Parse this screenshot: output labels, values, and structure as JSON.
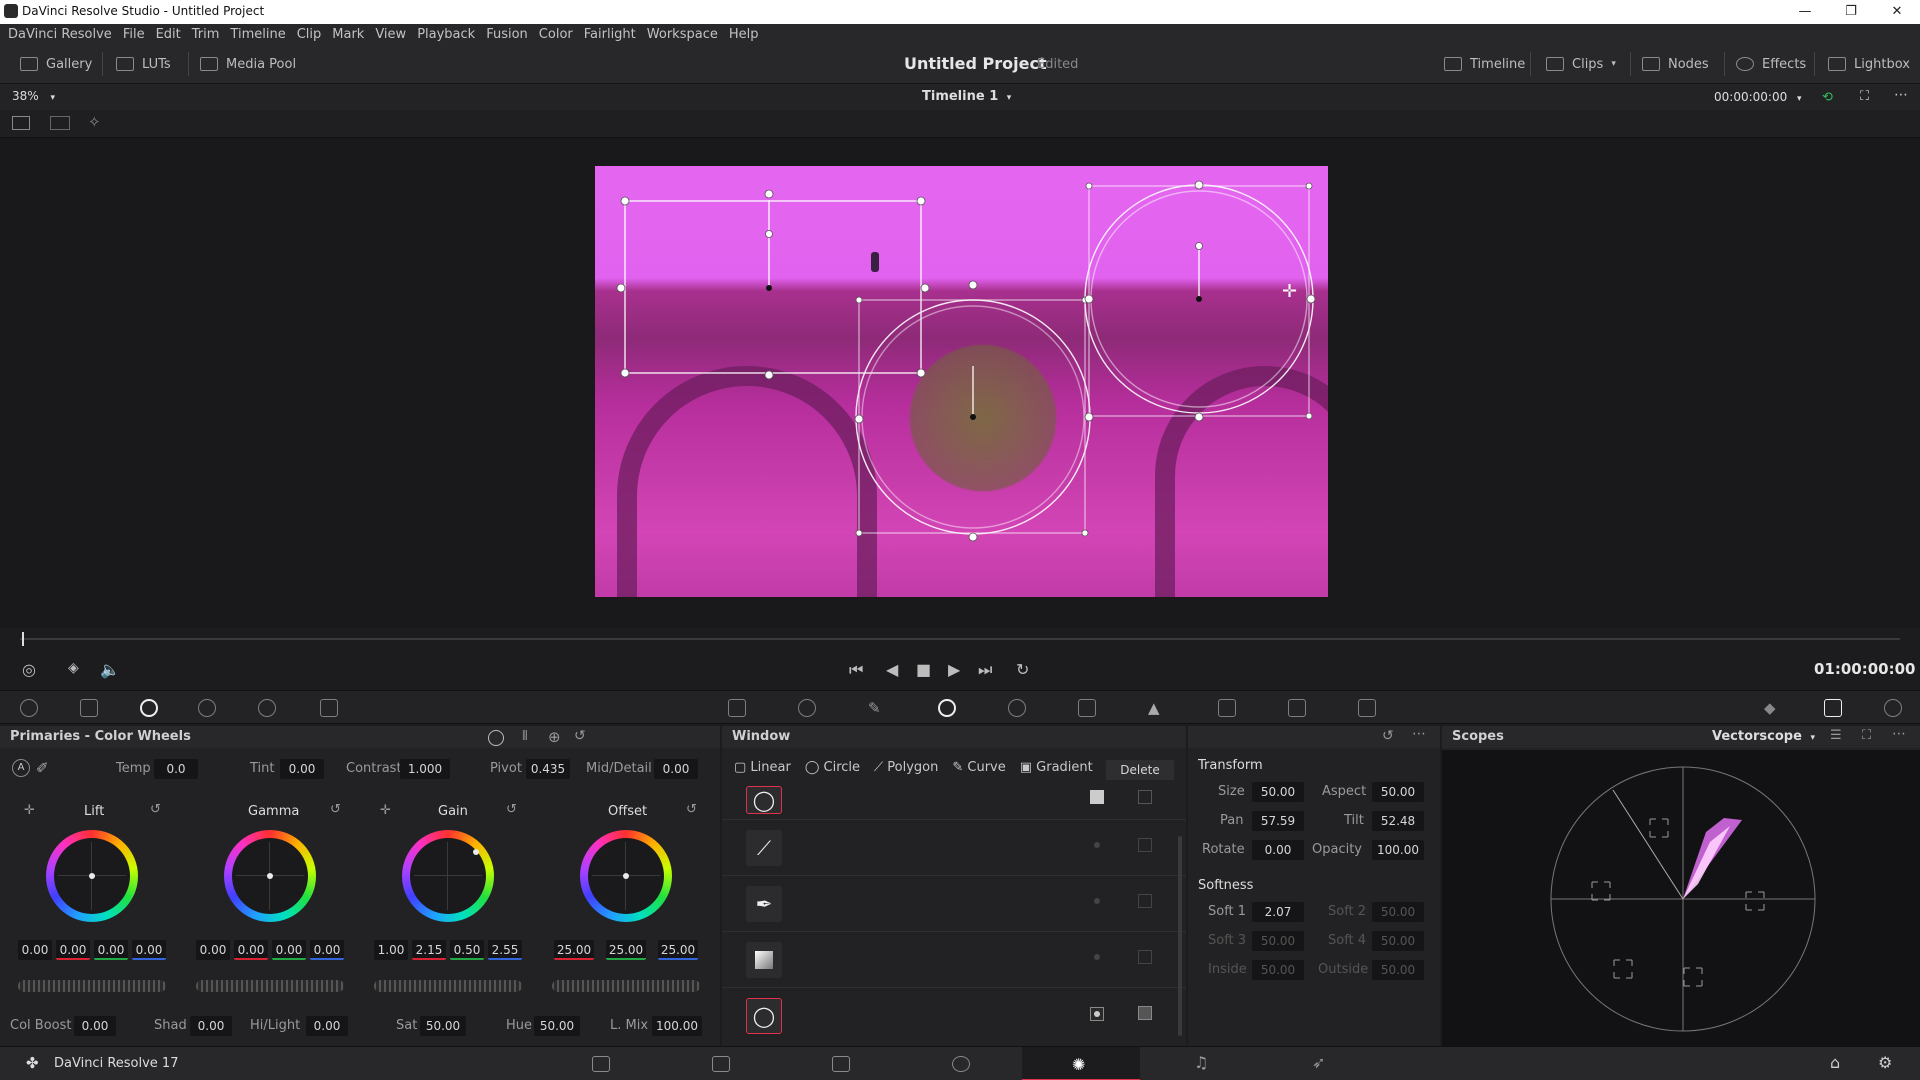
{
  "window": {
    "title": "DaVinci Resolve Studio - Untitled Project",
    "minimize": "—",
    "maximize": "❐",
    "close": "✕"
  },
  "menu": [
    "DaVinci Resolve",
    "File",
    "Edit",
    "Trim",
    "Timeline",
    "Clip",
    "Mark",
    "View",
    "Playback",
    "Fusion",
    "Color",
    "Fairlight",
    "Workspace",
    "Help"
  ],
  "toolbar": {
    "gallery": "Gallery",
    "luts": "LUTs",
    "media_pool": "Media Pool",
    "project_title": "Untitled Project",
    "project_status": "Edited",
    "timeline": "Timeline",
    "clips": "Clips",
    "nodes": "Nodes",
    "effects": "Effects",
    "lightbox": "Lightbox"
  },
  "viewer": {
    "zoom": "38%",
    "timeline_name": "Timeline 1",
    "timecode_top": "00:00:00:00",
    "timecode": "01:00:00:00"
  },
  "color_wheels": {
    "title": "Primaries - Color Wheels",
    "temp_label": "Temp",
    "temp": "0.0",
    "tint_label": "Tint",
    "tint": "0.00",
    "contrast_label": "Contrast",
    "contrast": "1.000",
    "pivot_label": "Pivot",
    "pivot": "0.435",
    "middetail_label": "Mid/Detail",
    "middetail": "0.00",
    "wheels": [
      {
        "name": "Lift",
        "values": [
          "0.00",
          "0.00",
          "0.00",
          "0.00"
        ]
      },
      {
        "name": "Gamma",
        "values": [
          "0.00",
          "0.00",
          "0.00",
          "0.00"
        ]
      },
      {
        "name": "Gain",
        "values": [
          "1.00",
          "2.15",
          "0.50",
          "2.55"
        ]
      },
      {
        "name": "Offset",
        "values": [
          "25.00",
          "25.00",
          "25.00"
        ]
      }
    ],
    "colboost_label": "Col Boost",
    "colboost": "0.00",
    "shad_label": "Shad",
    "shad": "0.00",
    "hilight_label": "Hi/Light",
    "hilight": "0.00",
    "sat_label": "Sat",
    "sat": "50.00",
    "hue_label": "Hue",
    "hue": "50.00",
    "lmix_label": "L. Mix",
    "lmix": "100.00"
  },
  "window_panel": {
    "title": "Window",
    "linear": "Linear",
    "circle": "Circle",
    "polygon": "Polygon",
    "curve": "Curve",
    "gradient": "Gradient",
    "delete": "Delete"
  },
  "transform": {
    "title": "Transform",
    "size_label": "Size",
    "size": "50.00",
    "aspect_label": "Aspect",
    "aspect": "50.00",
    "pan_label": "Pan",
    "pan": "57.59",
    "tilt_label": "Tilt",
    "tilt": "52.48",
    "rotate_label": "Rotate",
    "rotate": "0.00",
    "opacity_label": "Opacity",
    "opacity": "100.00",
    "softness_title": "Softness",
    "soft1_label": "Soft 1",
    "soft1": "2.07",
    "soft2_label": "Soft 2",
    "soft2": "50.00",
    "soft3_label": "Soft 3",
    "soft3": "50.00",
    "soft4_label": "Soft 4",
    "soft4": "50.00",
    "inside_label": "Inside",
    "inside": "50.00",
    "outside_label": "Outside",
    "outside": "50.00"
  },
  "scopes": {
    "title": "Scopes",
    "mode": "Vectorscope"
  },
  "bottom": {
    "app_name": "DaVinci Resolve 17"
  },
  "colors": {
    "accent": "#e0304a",
    "magenta": "#e066f0"
  }
}
